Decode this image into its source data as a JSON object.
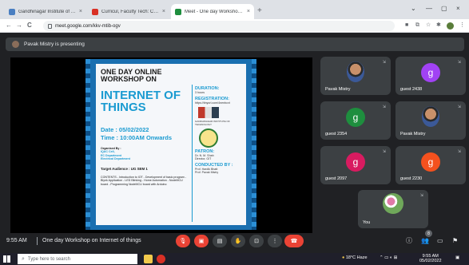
{
  "browser": {
    "tabs": [
      {
        "title": "Gandhinagar Institute of Technol",
        "favicon_color": "#4a7fc1",
        "active": false
      },
      {
        "title": "Curricul, Faculty Tech: Class XI",
        "favicon_color": "#d93025",
        "active": false
      },
      {
        "title": "Meet - One day Workshop o",
        "favicon_color": "#1e8e3e",
        "active": true
      }
    ],
    "close_glyph": "×",
    "new_tab_glyph": "+",
    "window_controls": [
      "⌄",
      "—",
      "▢",
      "×"
    ],
    "nav": {
      "back": "←",
      "forward": "→",
      "reload": "C"
    },
    "url": "meet.google.com/kkv-mtib-ogv",
    "toolbar_icons": [
      "camera-icon",
      "tab-search-icon",
      "star-icon",
      "extensions-icon",
      "profile-icon",
      "menu-icon"
    ]
  },
  "meet": {
    "presenting_text": "Pavak Mistry is presenting",
    "slide": {
      "heading_line1": "ONE DAY ONLINE",
      "heading_line2": "WORKSHOP ON",
      "topic_line1": "INTERNET OF",
      "topic_line2": "THINGS",
      "date": "Date : 05/02/2022",
      "time": "Time : 10:00AM Onwards",
      "organised_by": [
        "Organised By :",
        "IQAC Cell,",
        "EC Department",
        "Electrical Department"
      ],
      "target_audience": "Target Audience : UG SEM 1",
      "contents": "CONTENTS - Introduction to IOT - Development of basic program - Blynk Application - LED Blinking - Home Automation - NodeMCU board - Programming NodeMCU board with Arduino",
      "duration_h": "DURATION:",
      "duration_v": "3 hours",
      "registration_h": "REGISTRATION:",
      "registration_v": "https://tinyurl.com/4nenbcxt",
      "institute_name": "GANDHINAGAR INSTITUTE OF TECHNOLOGY",
      "patron_h": "PATRON:",
      "patron_v": [
        "Dr. N. M. Shah",
        "Director, GIT"
      ],
      "conducted_h": "CONDUCTED BY :",
      "conducted_v": [
        "Prof. Hardik Bhatt",
        "Prof. Pavak Mistry"
      ]
    },
    "participants": [
      {
        "name": "Pavak Mistry",
        "kind": "photo"
      },
      {
        "name": "guest 2438",
        "kind": "initial",
        "initial": "g",
        "color": "#a142f4"
      },
      {
        "name": "guest 2354",
        "kind": "initial",
        "initial": "g",
        "color": "#1e8e3e"
      },
      {
        "name": "Pavak Mistry",
        "kind": "photo"
      },
      {
        "name": "guest 2097",
        "kind": "initial",
        "initial": "g",
        "color": "#d81b60"
      },
      {
        "name": "guest 2230",
        "kind": "initial",
        "initial": "g",
        "color": "#f4511e"
      },
      {
        "name": "You",
        "kind": "flower"
      }
    ],
    "pin_glyph": "⇲",
    "bottom": {
      "time": "9:55 AM",
      "meeting_name": "One day Workshop on Internet of things",
      "people_badge": "8"
    }
  },
  "taskbar": {
    "search_placeholder": "Type here to search",
    "weather": "18°C Haze",
    "clock_time": "9:55 AM",
    "clock_date": "05/02/2022"
  }
}
